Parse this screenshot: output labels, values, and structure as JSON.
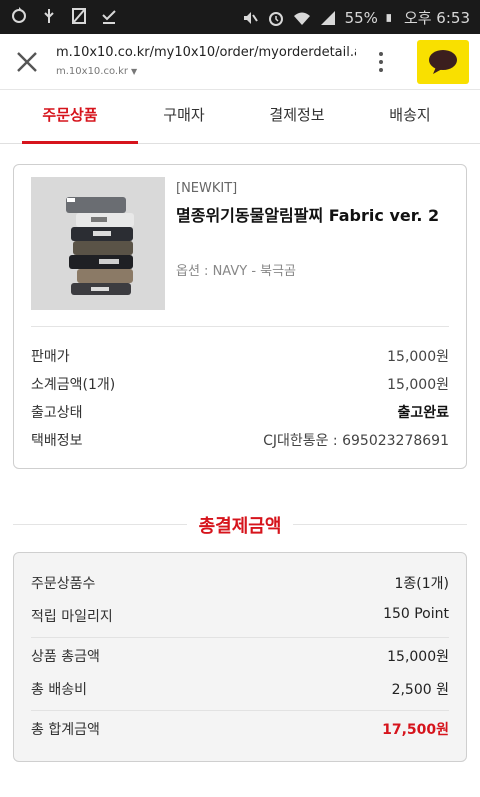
{
  "status_bar": {
    "battery_text": "55%",
    "clock": "오후 6:53"
  },
  "browser": {
    "url": "m.10x10.co.kr/my10x10/order/myorderdetail.asp...",
    "domain": "m.10x10.co.kr"
  },
  "tabs": [
    {
      "label": "주문상품"
    },
    {
      "label": "구매자"
    },
    {
      "label": "결제정보"
    },
    {
      "label": "배송지"
    }
  ],
  "product": {
    "brand": "[NEWKIT]",
    "name": "멸종위기동물알림팔찌 Fabric ver. 2",
    "option": "옵션 : NAVY - 북극곰",
    "details": [
      {
        "label": "판매가",
        "value": "15,000원"
      },
      {
        "label": "소계금액(1개)",
        "value": "15,000원"
      },
      {
        "label": "출고상태",
        "value": "출고완료"
      },
      {
        "label": "택배정보",
        "value": "CJ대한통운 : 695023278691"
      }
    ]
  },
  "total": {
    "title": "총결제금액",
    "rows": [
      {
        "label": "주문상품수",
        "value": "1종(1개)"
      },
      {
        "label": "적립 마일리지",
        "value": "150 Point"
      },
      {
        "label": "상품 총금액",
        "value": "15,000원"
      },
      {
        "label": "총 배송비",
        "value": "2,500 원"
      },
      {
        "label": "총 합계금액",
        "value": "17,500원"
      }
    ]
  },
  "colors": {
    "accent": "#d6141c",
    "kakao_yellow": "#f9e000"
  },
  "icons": [
    "close-icon",
    "more-vert-icon",
    "chat-bubble-icon",
    "chevron-down-icon"
  ]
}
